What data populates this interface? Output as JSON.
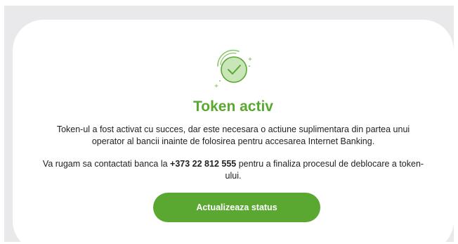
{
  "status_card": {
    "icon": "check-circle-icon",
    "title": "Token activ",
    "description": "Token-ul a fost activat cu succes, dar este necesara o actiune suplimentara din partea unui operator al bancii inainte de folosirea pentru accesarea Internet Banking.",
    "contact_prefix": "Va rugam sa contactati banca la ",
    "phone": "+373 22 812 555",
    "contact_suffix": " pentru a finaliza procesul de deblocare a token-ului.",
    "button_label": "Actualizeaza status"
  },
  "colors": {
    "accent": "#5aa832",
    "icon_fill": "#c8e6b8",
    "background": "#e9e9ec"
  }
}
